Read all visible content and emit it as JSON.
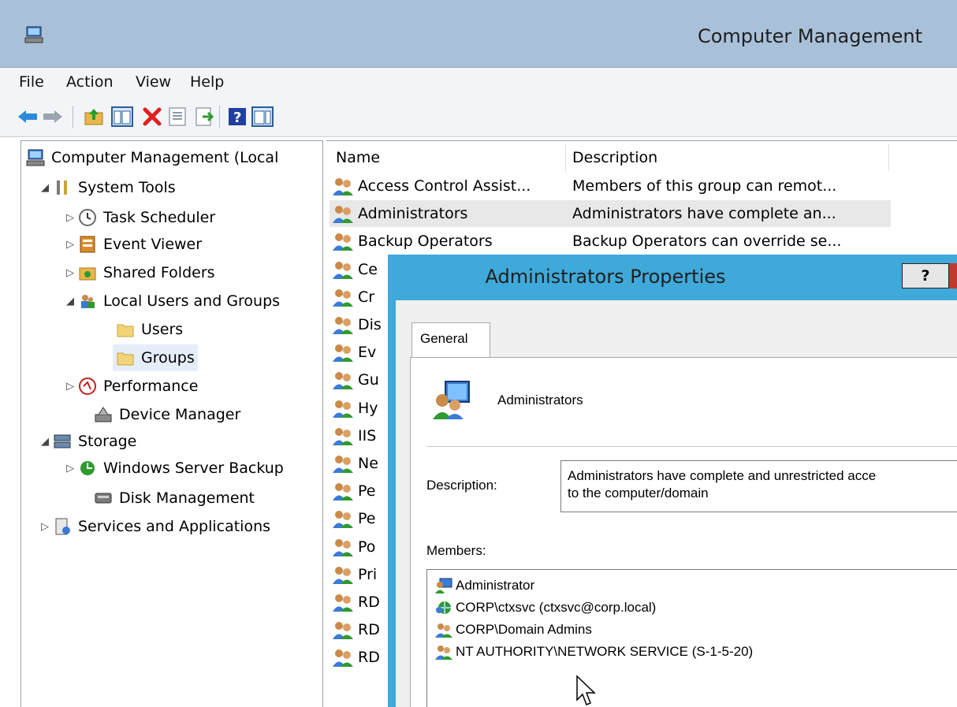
{
  "window": {
    "title": "Computer Management"
  },
  "menu": {
    "items": [
      "File",
      "Action",
      "View",
      "Help"
    ]
  },
  "toolbar": {
    "buttons": [
      "back-arrow-icon",
      "forward-arrow-icon",
      "up-folder-icon",
      "show-hide-tree-icon",
      "delete-icon",
      "properties-icon",
      "export-list-icon",
      "help-icon",
      "action-pane-icon"
    ],
    "colors": {
      "back": "#2b8ad8",
      "delete": "#e02020",
      "help": "#2040a0"
    }
  },
  "tree": {
    "items": [
      {
        "label": "Computer Management (Local",
        "icon": "computer-management-icon"
      },
      {
        "label": "System Tools",
        "icon": "tools-icon"
      },
      {
        "label": "Task Scheduler",
        "icon": "clock-icon"
      },
      {
        "label": "Event Viewer",
        "icon": "event-viewer-icon"
      },
      {
        "label": "Shared Folders",
        "icon": "shared-folder-icon"
      },
      {
        "label": "Local Users and Groups",
        "icon": "users-icon"
      },
      {
        "label": "Users",
        "icon": "folder-icon"
      },
      {
        "label": "Groups",
        "icon": "folder-icon"
      },
      {
        "label": "Performance",
        "icon": "performance-icon"
      },
      {
        "label": "Device Manager",
        "icon": "device-manager-icon"
      },
      {
        "label": "Storage",
        "icon": "storage-icon"
      },
      {
        "label": "Windows Server Backup",
        "icon": "backup-icon"
      },
      {
        "label": "Disk Management",
        "icon": "disk-icon"
      },
      {
        "label": "Services and Applications",
        "icon": "services-icon"
      }
    ],
    "expanders": {
      "expanded": "◢",
      "collapsed": "▷"
    }
  },
  "list": {
    "columns": [
      "Name",
      "Description"
    ],
    "rows": [
      {
        "name": "Access Control Assist...",
        "description": "Members of this group can remot..."
      },
      {
        "name": "Administrators",
        "description": "Administrators have complete an..."
      },
      {
        "name": "Backup Operators",
        "description": "Backup Operators can override se..."
      },
      {
        "name": "Ce",
        "description": ""
      },
      {
        "name": "Cr",
        "description": ""
      },
      {
        "name": "Dis",
        "description": ""
      },
      {
        "name": "Ev",
        "description": ""
      },
      {
        "name": "Gu",
        "description": ""
      },
      {
        "name": "Hy",
        "description": ""
      },
      {
        "name": "IIS",
        "description": ""
      },
      {
        "name": "Ne",
        "description": ""
      },
      {
        "name": "Pe",
        "description": ""
      },
      {
        "name": "Pe",
        "description": ""
      },
      {
        "name": "Po",
        "description": ""
      },
      {
        "name": "Pri",
        "description": ""
      },
      {
        "name": "RD",
        "description": ""
      },
      {
        "name": "RD",
        "description": ""
      },
      {
        "name": "RD",
        "description": ""
      }
    ]
  },
  "dialog": {
    "title": "Administrators Properties",
    "help_label": "?",
    "tab_label": "General",
    "group_name": "Administrators",
    "description_label": "Description:",
    "description_line1": "Administrators have complete and unrestricted acce",
    "description_line2": "to the computer/domain",
    "members_label": "Members:",
    "members": [
      {
        "name": "Administrator",
        "icon": "user-icon"
      },
      {
        "name": "CORP\\ctxsvc (ctxsvc@corp.local)",
        "icon": "domain-user-icon"
      },
      {
        "name": "CORP\\Domain Admins",
        "icon": "group-icon"
      },
      {
        "name": "NT AUTHORITY\\NETWORK SERVICE (S-1-5-20)",
        "icon": "group-icon"
      }
    ]
  }
}
